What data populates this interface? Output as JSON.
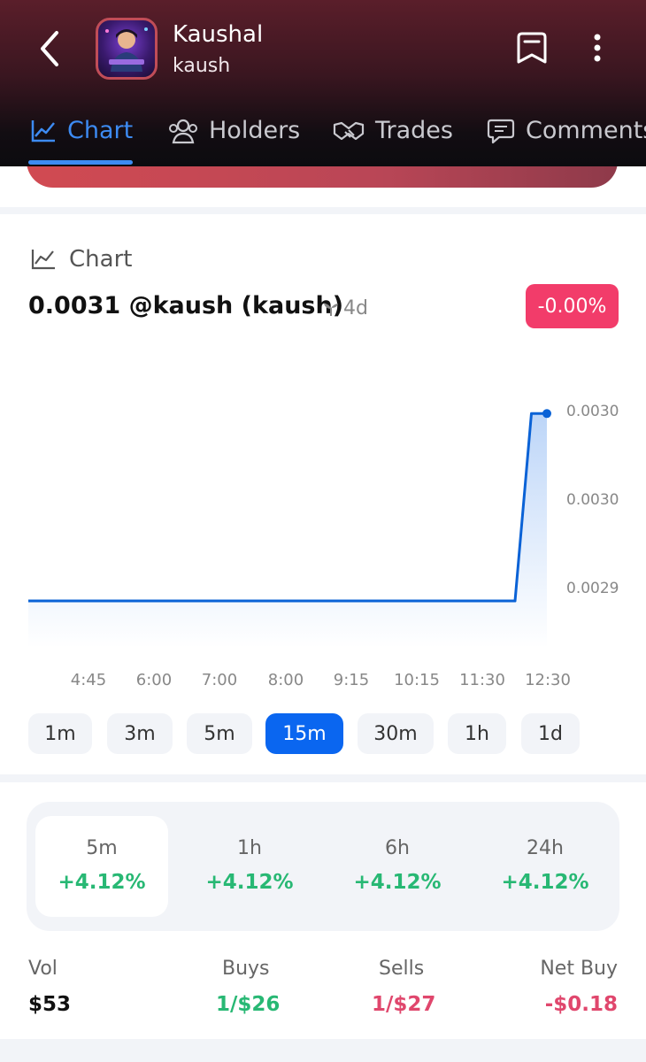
{
  "header": {
    "title": "Kaushal",
    "subtitle": "kaush"
  },
  "tabs": [
    {
      "label": "Chart",
      "icon": "line-chart-icon",
      "active": true
    },
    {
      "label": "Holders",
      "icon": "users-icon",
      "active": false
    },
    {
      "label": "Trades",
      "icon": "handshake-icon",
      "active": false
    },
    {
      "label": "Comments",
      "icon": "comment-icon",
      "active": false
    }
  ],
  "chart_section": {
    "label": "Chart",
    "price_line": "0.0031 @kaush (kaush)",
    "age": "4d",
    "change": "-0.00%",
    "colors": {
      "line": "#0a62d6",
      "change_pill": "#f23c6a"
    }
  },
  "chart_data": {
    "type": "area",
    "x": [
      "4:45",
      "6:00",
      "7:00",
      "8:00",
      "9:15",
      "10:15",
      "11:30",
      "12:30"
    ],
    "y_ticks": [
      "0.0030",
      "0.0030",
      "0.0029"
    ],
    "series": [
      {
        "points": [
          {
            "x": "4:45",
            "y": 0.00295
          },
          {
            "x": "6:00",
            "y": 0.00295
          },
          {
            "x": "7:00",
            "y": 0.00295
          },
          {
            "x": "8:00",
            "y": 0.00295
          },
          {
            "x": "9:15",
            "y": 0.00295
          },
          {
            "x": "10:15",
            "y": 0.00295
          },
          {
            "x": "11:30",
            "y": 0.00295
          },
          {
            "x": "12:00",
            "y": 0.00295
          },
          {
            "x": "12:15",
            "y": 0.00307
          },
          {
            "x": "12:30",
            "y": 0.00307
          }
        ]
      }
    ],
    "ylim": [
      0.00292,
      0.00309
    ],
    "grid": false
  },
  "timeframes": {
    "options": [
      "1m",
      "3m",
      "5m",
      "15m",
      "30m",
      "1h",
      "1d"
    ],
    "selected": "15m"
  },
  "performance": [
    {
      "label": "5m",
      "value": "+4.12%",
      "active": true
    },
    {
      "label": "1h",
      "value": "+4.12%",
      "active": false
    },
    {
      "label": "6h",
      "value": "+4.12%",
      "active": false
    },
    {
      "label": "24h",
      "value": "+4.12%",
      "active": false
    }
  ],
  "kpis": {
    "vol": {
      "label": "Vol",
      "value": "$53"
    },
    "buys": {
      "label": "Buys",
      "value": "1/$26"
    },
    "sells": {
      "label": "Sells",
      "value": "1/$27"
    },
    "net_buy": {
      "label": "Net Buy",
      "value": "-$0.18"
    }
  }
}
